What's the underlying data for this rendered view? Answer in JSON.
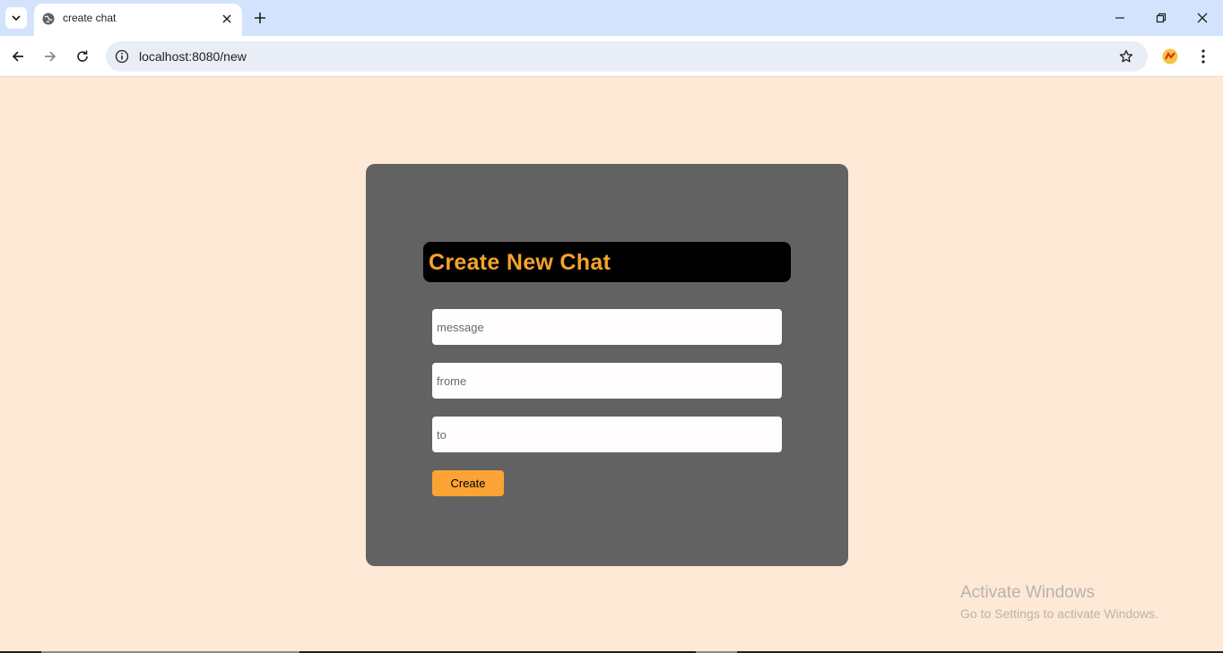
{
  "browser": {
    "tab_title": "create chat",
    "url": "localhost:8080/new"
  },
  "colors": {
    "page_background": "#fee9d7",
    "card_background": "#626262",
    "heading_text": "#f5a32a",
    "heading_background": "#000000",
    "button_background": "#fba334",
    "tabstrip": "#d3e3fd"
  },
  "form": {
    "heading": "Create New Chat",
    "fields": [
      {
        "name": "message",
        "placeholder": "message",
        "value": ""
      },
      {
        "name": "frome",
        "placeholder": "frome",
        "value": ""
      },
      {
        "name": "to",
        "placeholder": "to",
        "value": ""
      }
    ],
    "submit_label": "Create"
  },
  "watermark": {
    "title": "Activate Windows",
    "subtitle": "Go to Settings to activate Windows."
  },
  "icons": {
    "tab_search": "chevron-down-icon",
    "favicon": "globe-icon",
    "tab_close": "close-icon",
    "new_tab": "plus-icon",
    "minimize": "minimize-icon",
    "restore": "restore-icon",
    "close_window": "close-icon",
    "back": "arrow-left-icon",
    "forward": "arrow-right-icon",
    "reload": "reload-icon",
    "site_info": "info-icon",
    "bookmark": "star-icon",
    "extension": "extension-icon",
    "menu": "more-vert-icon"
  }
}
